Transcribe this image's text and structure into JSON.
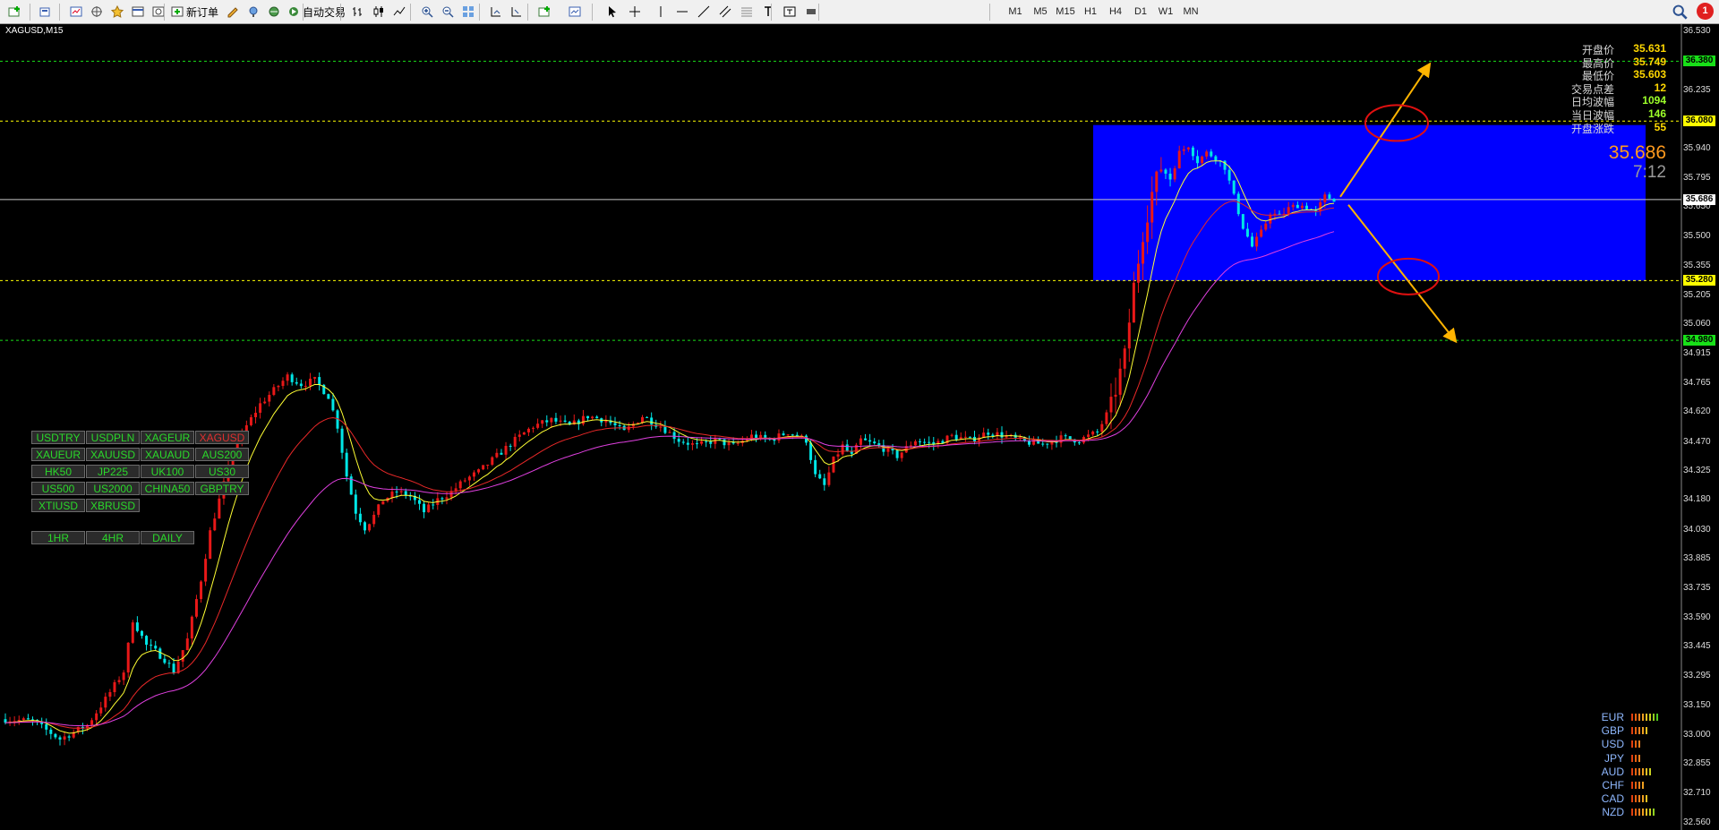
{
  "toolbar": {
    "new_order_label": "新订单",
    "auto_trade_label": "自动交易",
    "timeframes": [
      "M1",
      "M5",
      "M15",
      "H1",
      "H4",
      "D1",
      "W1",
      "MN"
    ],
    "active_timeframe": "M15",
    "icons": [
      "new-chart-icon",
      "profiles-icon",
      "market-watch-icon",
      "navigator-icon",
      "favorites-icon",
      "terminal-icon",
      "strategy-tester-icon",
      "new-order-icon",
      "metaeditor-icon",
      "signals-icon",
      "vps-icon",
      "auto-trading-icon",
      "bar-chart-icon",
      "candlestick-icon",
      "line-chart-icon",
      "zoom-in-icon",
      "zoom-out-icon",
      "tile-windows-icon",
      "auto-scroll-icon",
      "chart-shift-icon",
      "indicators-icon",
      "templates-icon",
      "cursor-icon",
      "crosshair-icon",
      "vertical-line-icon",
      "horizontal-line-icon",
      "trendline-icon",
      "equidistant-channel-icon",
      "fibonacci-icon",
      "text-icon",
      "text-label-icon",
      "arrows-icon",
      "search-icon"
    ],
    "notification_count": "1"
  },
  "chart": {
    "title": "XAGUSD,M15",
    "bid_price": "35.686",
    "countdown": "7:12",
    "info_panel": [
      {
        "label": "开盘价",
        "value": "35.631",
        "color": "#ffd700"
      },
      {
        "label": "最高价",
        "value": "35.749",
        "color": "#ffd700"
      },
      {
        "label": "最低价",
        "value": "35.603",
        "color": "#ffd700"
      },
      {
        "label": "交易点差",
        "value": "12",
        "color": "#ffd700"
      },
      {
        "label": "日均波幅",
        "value": "1094",
        "color": "#9dff2a"
      },
      {
        "label": "当日波幅",
        "value": "146",
        "color": "#9dff2a"
      },
      {
        "label": "开盘涨跌",
        "value": "55",
        "color": "#ffd700"
      }
    ],
    "axis_prices": [
      "36.530",
      "36.380",
      "36.235",
      "36.080",
      "35.940",
      "35.795",
      "35.650",
      "35.500",
      "35.355",
      "35.280",
      "35.205",
      "35.060",
      "34.980",
      "34.915",
      "34.765",
      "34.620",
      "34.470",
      "34.325",
      "34.180",
      "34.030",
      "33.885",
      "33.735",
      "33.590",
      "33.445",
      "33.295",
      "33.150",
      "33.000",
      "32.855",
      "32.710",
      "32.560"
    ],
    "axis_tags": [
      {
        "value": "36.380",
        "bg": "#18e018"
      },
      {
        "value": "36.080",
        "bg": "#ffff00"
      },
      {
        "value": "35.686",
        "bg": "#ffffff"
      },
      {
        "value": "35.280",
        "bg": "#ffff00"
      },
      {
        "value": "34.980",
        "bg": "#18e018"
      }
    ],
    "colors": {
      "bull": "#e81818",
      "bear": "#00e6e6",
      "ma_fast": "#ffff33",
      "ma_mid": "#e82828",
      "ma_slow": "#e040e0",
      "zone": "#0000ff",
      "arrow": "#ffb400"
    }
  },
  "symbol_buttons": [
    [
      "USDTRY",
      "USDPLN",
      "XAGEUR",
      "XAGUSD"
    ],
    [
      "XAUEUR",
      "XAUUSD",
      "XAUAUD",
      "AUS200"
    ],
    [
      "HK50",
      "JP225",
      "UK100",
      "US30"
    ],
    [
      "US500",
      "US2000",
      "CHINA50",
      "GBPTRY"
    ],
    [
      "XTIUSD",
      "XBRUSD"
    ]
  ],
  "active_symbol": "XAGUSD",
  "timeframe_buttons": [
    "1HR",
    "4HR",
    "DAILY"
  ],
  "currency_strength": [
    {
      "label": "EUR",
      "level": 8
    },
    {
      "label": "GBP",
      "level": 5
    },
    {
      "label": "USD",
      "level": 3
    },
    {
      "label": "JPY",
      "level": 3
    },
    {
      "label": "AUD",
      "level": 6
    },
    {
      "label": "CHF",
      "level": 4
    },
    {
      "label": "CAD",
      "level": 5
    },
    {
      "label": "NZD",
      "level": 7
    }
  ],
  "chart_data": {
    "type": "candlestick",
    "symbol": "XAGUSD",
    "timeframe": "M15",
    "ylim": [
      32.56,
      36.53
    ],
    "horizontal_levels": [
      {
        "price": 36.38,
        "style": "dashed",
        "color": "#18e018"
      },
      {
        "price": 36.08,
        "style": "dashed",
        "color": "#ffff00"
      },
      {
        "price": 35.686,
        "style": "solid",
        "color": "#c8c8c8"
      },
      {
        "price": 35.28,
        "style": "dashed",
        "color": "#ffff00"
      },
      {
        "price": 34.98,
        "style": "dashed",
        "color": "#18e018"
      }
    ],
    "zone": {
      "from": 35.28,
      "to": 36.06
    },
    "close_series_anchor": [
      [
        0,
        33.08
      ],
      [
        6,
        33.07
      ],
      [
        12,
        32.98
      ],
      [
        18,
        33.05
      ],
      [
        22,
        33.18
      ],
      [
        26,
        33.32
      ],
      [
        28,
        33.58
      ],
      [
        31,
        33.45
      ],
      [
        33,
        33.42
      ],
      [
        35,
        33.38
      ],
      [
        37,
        33.32
      ],
      [
        40,
        33.48
      ],
      [
        43,
        33.78
      ],
      [
        45,
        34.02
      ],
      [
        47,
        34.18
      ],
      [
        50,
        34.42
      ],
      [
        53,
        34.55
      ],
      [
        56,
        34.66
      ],
      [
        59,
        34.73
      ],
      [
        62,
        34.8
      ],
      [
        65,
        34.76
      ],
      [
        68,
        34.78
      ],
      [
        71,
        34.7
      ],
      [
        73,
        34.55
      ],
      [
        75,
        34.3
      ],
      [
        77,
        34.12
      ],
      [
        79,
        34.04
      ],
      [
        81,
        34.1
      ],
      [
        83,
        34.18
      ],
      [
        86,
        34.22
      ],
      [
        89,
        34.2
      ],
      [
        92,
        34.12
      ],
      [
        95,
        34.18
      ],
      [
        98,
        34.22
      ],
      [
        101,
        34.28
      ],
      [
        104,
        34.32
      ],
      [
        108,
        34.4
      ],
      [
        112,
        34.48
      ],
      [
        116,
        34.55
      ],
      [
        120,
        34.58
      ],
      [
        124,
        34.55
      ],
      [
        128,
        34.6
      ],
      [
        132,
        34.58
      ],
      [
        136,
        34.52
      ],
      [
        140,
        34.6
      ],
      [
        144,
        34.55
      ],
      [
        148,
        34.48
      ],
      [
        152,
        34.45
      ],
      [
        156,
        34.48
      ],
      [
        160,
        34.45
      ],
      [
        164,
        34.5
      ],
      [
        168,
        34.48
      ],
      [
        172,
        34.52
      ],
      [
        176,
        34.48
      ],
      [
        178,
        34.3
      ],
      [
        180,
        34.25
      ],
      [
        182,
        34.38
      ],
      [
        184,
        34.45
      ],
      [
        186,
        34.4
      ],
      [
        188,
        34.48
      ],
      [
        192,
        34.45
      ],
      [
        196,
        34.4
      ],
      [
        200,
        34.48
      ],
      [
        204,
        34.46
      ],
      [
        208,
        34.5
      ],
      [
        212,
        34.48
      ],
      [
        216,
        34.52
      ],
      [
        220,
        34.5
      ],
      [
        224,
        34.47
      ],
      [
        228,
        34.46
      ],
      [
        232,
        34.49
      ],
      [
        236,
        34.48
      ],
      [
        240,
        34.52
      ],
      [
        243,
        34.65
      ],
      [
        246,
        34.9
      ],
      [
        248,
        35.25
      ],
      [
        250,
        35.52
      ],
      [
        252,
        35.72
      ],
      [
        254,
        35.85
      ],
      [
        256,
        35.8
      ],
      [
        258,
        35.92
      ],
      [
        260,
        35.96
      ],
      [
        262,
        35.88
      ],
      [
        264,
        35.92
      ],
      [
        266,
        35.9
      ],
      [
        268,
        35.85
      ],
      [
        270,
        35.7
      ],
      [
        272,
        35.55
      ],
      [
        274,
        35.45
      ],
      [
        276,
        35.52
      ],
      [
        278,
        35.62
      ],
      [
        280,
        35.6
      ],
      [
        282,
        35.64
      ],
      [
        284,
        35.66
      ],
      [
        286,
        35.65
      ],
      [
        288,
        35.62
      ],
      [
        290,
        35.7
      ],
      [
        292,
        35.69
      ]
    ],
    "moving_averages": [
      {
        "color": "#ffff33",
        "period": "fast"
      },
      {
        "color": "#e82828",
        "period": "mid"
      },
      {
        "color": "#e040e0",
        "period": "slow"
      }
    ]
  }
}
